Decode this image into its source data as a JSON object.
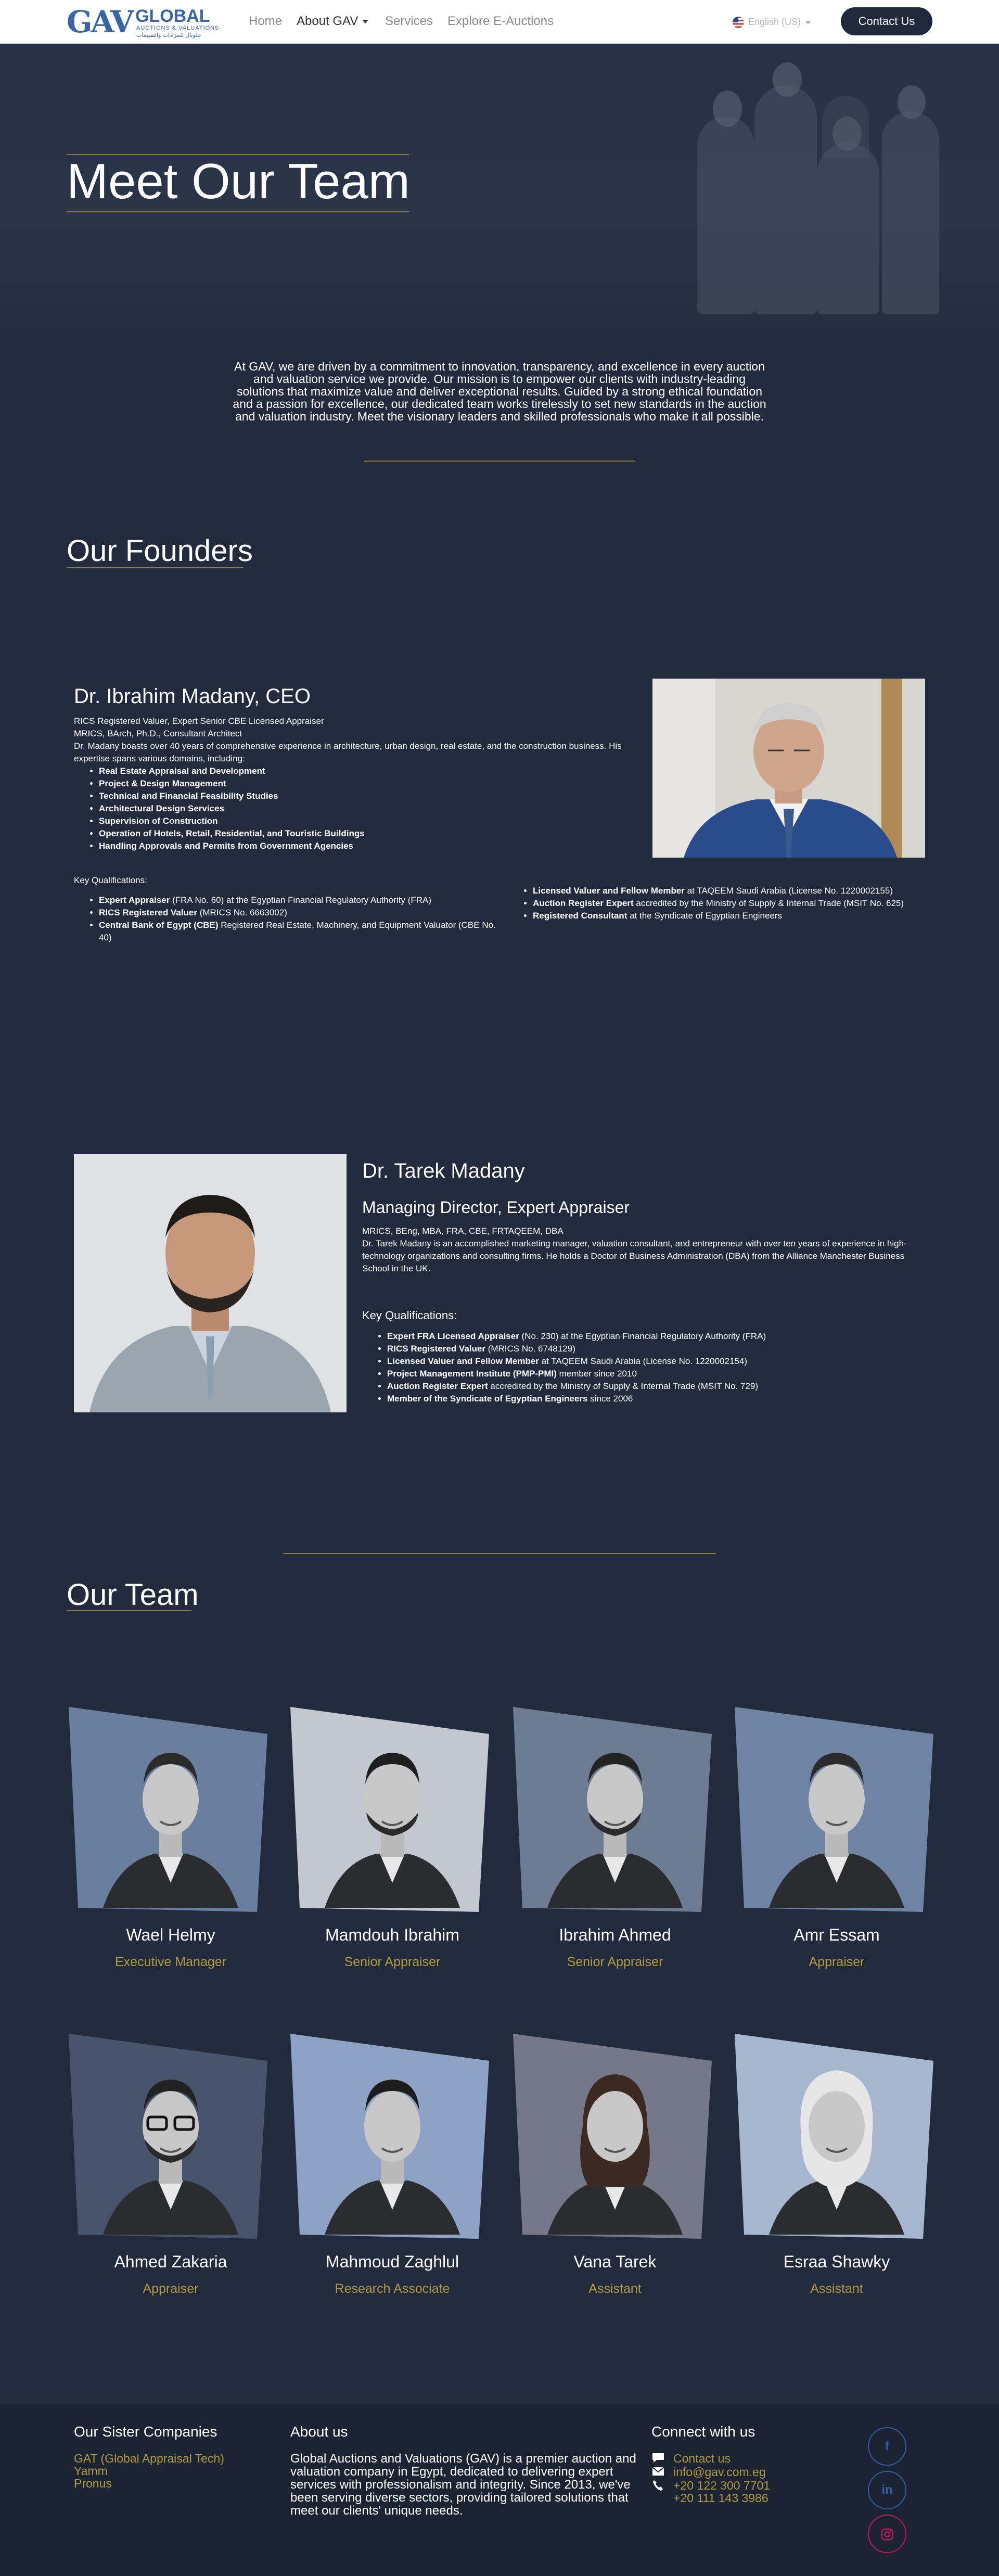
{
  "brand": {
    "logo_mark": "GAV",
    "logo_name": "GLOBAL",
    "logo_sub": "AUCTIONS & VALUATIONS",
    "logo_arabic": "جلوبال للمزادات والتقييمات",
    "accent_color": "#b29a3c",
    "navy_color": "#222b3d"
  },
  "nav": {
    "items": [
      "Home",
      "About GAV",
      "Services",
      "Explore E-Auctions"
    ],
    "language": "English (US)",
    "contact_label": "Contact Us"
  },
  "hero": {
    "title": "Meet Our Team"
  },
  "intro": {
    "text": "At GAV, we are driven by a commitment to innovation, transparency, and excellence in every auction and valuation service we provide. Our mission is to empower our clients with industry-leading solutions that maximize value and deliver exceptional results. Guided by a strong ethical foundation and a passion for excellence, our dedicated team works tirelessly to set new standards in the auction and valuation industry. Meet the visionary leaders and skilled professionals who make it all possible."
  },
  "founders_title": "Our Founders",
  "founder1": {
    "name": "Dr. Ibrahim Madany, CEO",
    "line1": "RICS Registered Valuer, Expert Senior CBE Licensed Appraiser",
    "line2": "MRICS, BArch, Ph.D., Consultant Architect",
    "bio": "Dr. Madany boasts over 40 years of comprehensive experience in architecture, urban design, real estate, and the construction business. His expertise spans various domains, including:",
    "domains": [
      "Real Estate Appraisal and Development",
      "Project & Design Management",
      "Technical and Financial Feasibility Studies",
      "Architectural Design Services",
      "Supervision of Construction",
      "Operation of Hotels, Retail, Residential, and Touristic Buildings",
      "Handling Approvals and Permits from Government Agencies"
    ],
    "kq_label": "Key Qualifications:",
    "quals_left": [
      {
        "b": "Expert Appraiser",
        "t": " (FRA No. 60) at the Egyptian Financial Regulatory Authority (FRA)"
      },
      {
        "b": "RICS Registered Valuer",
        "t": " (MRICS No. 6663002)"
      },
      {
        "b": "Central Bank of Egypt (CBE)",
        "t": " Registered Real Estate, Machinery, and Equipment Valuator (CBE No. 40)"
      }
    ],
    "quals_right": [
      {
        "b": "Licensed Valuer and Fellow Member",
        "t": " at TAQEEM Saudi Arabia (License No. 1220002155)"
      },
      {
        "b": "Auction Register Expert",
        "t": " accredited by the Ministry of Supply & Internal Trade (MSIT No. 625)"
      },
      {
        "b": "Registered Consultant",
        "t": " at the Syndicate of Egyptian Engineers"
      }
    ]
  },
  "founder2": {
    "name": "Dr. Tarek Madany",
    "role": "Managing Director, Expert Appraiser",
    "creds": "MRICS, BEng, MBA, FRA, CBE, FRTAQEEM, DBA",
    "bio": "Dr. Tarek Madany is an accomplished marketing manager, valuation consultant, and entrepreneur with over ten years of experience in high-technology organizations and consulting firms. He holds a Doctor of Business Administration (DBA) from the Alliance Manchester Business School in the UK.",
    "kq_label": "Key Qualifications:",
    "quals": [
      {
        "b": "Expert FRA Licensed Appraiser",
        "t": " (No. 230) at the Egyptian Financial Regulatory Authority (FRA)"
      },
      {
        "b": "RICS Registered Valuer",
        "t": " (MRICS No. 6748129)"
      },
      {
        "b": "Licensed Valuer and Fellow Member",
        "t": " at TAQEEM Saudi Arabia (License No. 1220002154)"
      },
      {
        "b": "Project Management Institute (PMP-PMI)",
        "t": " member since 2010"
      },
      {
        "b": "Auction Register Expert",
        "t": " accredited by the Ministry of Supply & Internal Trade (MSIT No. 729)"
      },
      {
        "b": "Member of the Syndicate of Egyptian Engineers",
        "t": " since 2006"
      }
    ]
  },
  "team_title": "Our Team",
  "team": [
    {
      "name": "Wael Helmy",
      "role": "Executive Manager"
    },
    {
      "name": "Mamdouh Ibrahim",
      "role": "Senior Appraiser"
    },
    {
      "name": "Ibrahim Ahmed",
      "role": "Senior Appraiser"
    },
    {
      "name": "Amr Essam",
      "role": "Appraiser"
    },
    {
      "name": "Ahmed Zakaria",
      "role": "Appraiser"
    },
    {
      "name": "Mahmoud Zaghlul",
      "role": "Research Associate"
    },
    {
      "name": "Vana Tarek",
      "role": "Assistant"
    },
    {
      "name": "Esraa Shawky",
      "role": "Assistant"
    }
  ],
  "footer": {
    "sister_title": "Our Sister Companies",
    "sister_links": [
      "GAT (Global Appraisal Tech)",
      "Yamm",
      "Pronus"
    ],
    "about_title": "About us",
    "about_text": "Global Auctions and Valuations (GAV) is a premier auction and valuation company in Egypt, dedicated to delivering expert services with professionalism and integrity. Since 2013, we've been serving diverse sectors, providing tailored solutions that meet our clients' unique needs.",
    "connect_title": "Connect with us",
    "contact_link": "Contact us",
    "email": "info@gav.com.eg",
    "phone1": "+20 122 300 7701",
    "phone2": "+20 111 143 3986",
    "social": [
      "facebook-icon",
      "linkedin-icon",
      "instagram-icon"
    ]
  }
}
